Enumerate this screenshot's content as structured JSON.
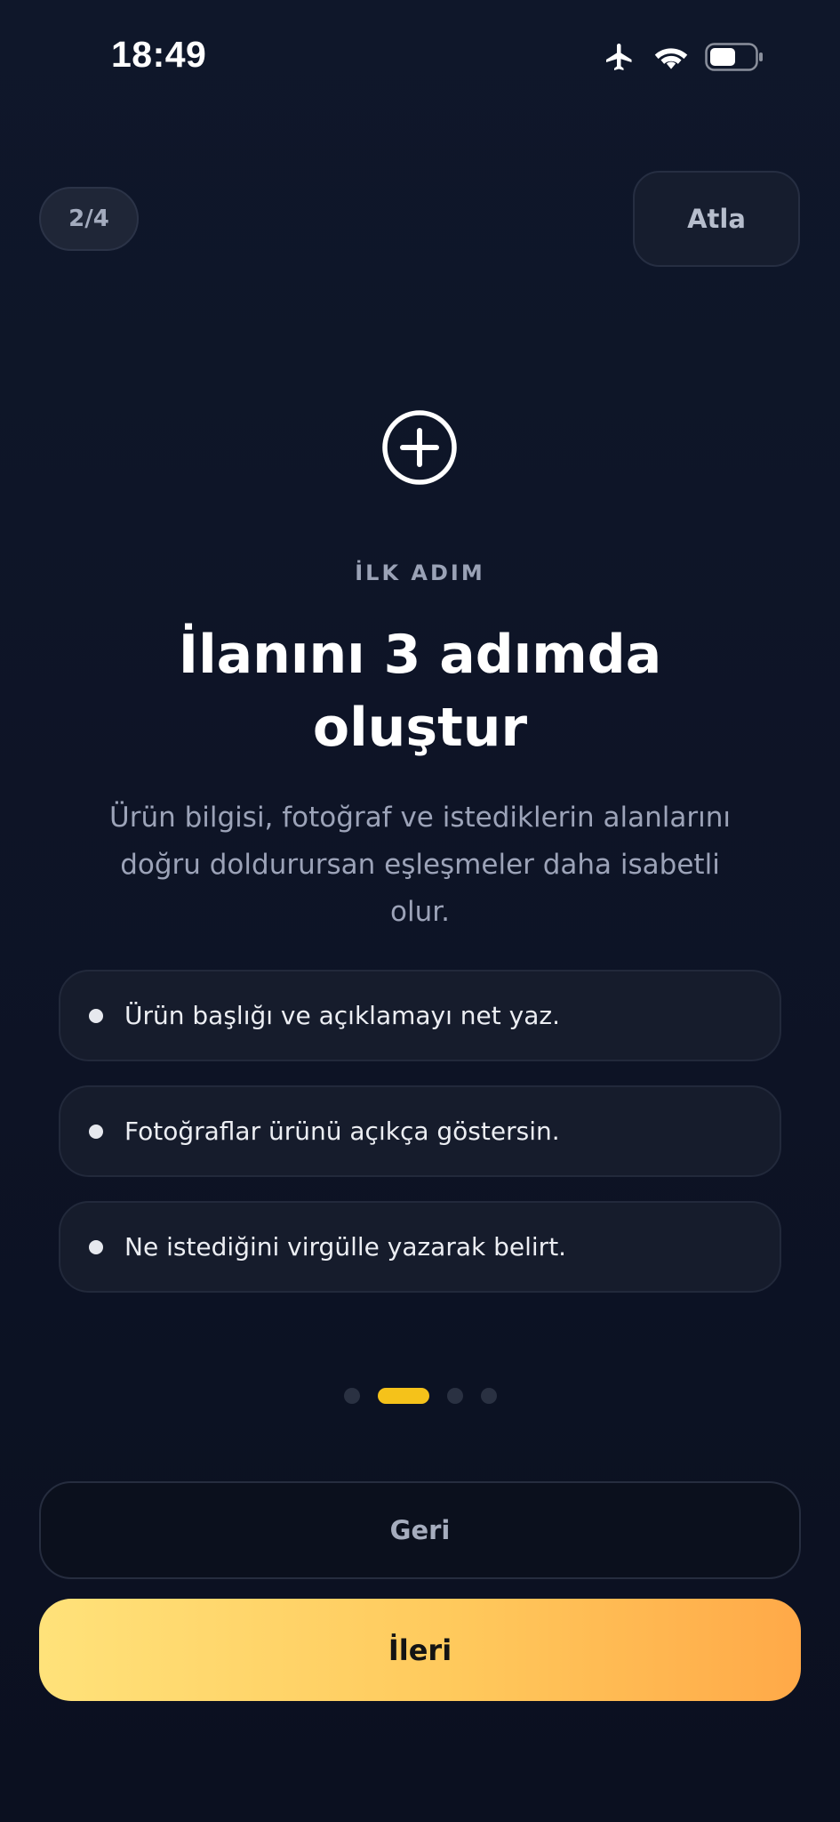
{
  "status_bar": {
    "time": "18:49",
    "icons": [
      "airplane-icon",
      "wifi-icon",
      "battery-icon"
    ]
  },
  "header": {
    "step_indicator": "2/4",
    "skip_label": "Atla"
  },
  "hero": {
    "icon": "plus-circle-icon"
  },
  "content": {
    "eyebrow": "İLK ADIM",
    "title": "İlanını 3 adımda oluştur",
    "subtitle": "Ürün bilgisi, fotoğraf ve istediklerin alanlarını doğru doldurursan eşleşmeler daha isabetli olur.",
    "tips": [
      "Ürün başlığı ve açıklamayı net yaz.",
      "Fotoğraflar ürünü açıkça göstersin.",
      "Ne istediğini virgülle yazarak belirt."
    ]
  },
  "pagination": {
    "total": 4,
    "current": 2
  },
  "actions": {
    "back_label": "Geri",
    "next_label": "İleri"
  },
  "colors": {
    "accent": "#f5c21a",
    "gradient_start": "#ffe27a",
    "gradient_end": "#ffa948",
    "background": "#0e1526"
  }
}
